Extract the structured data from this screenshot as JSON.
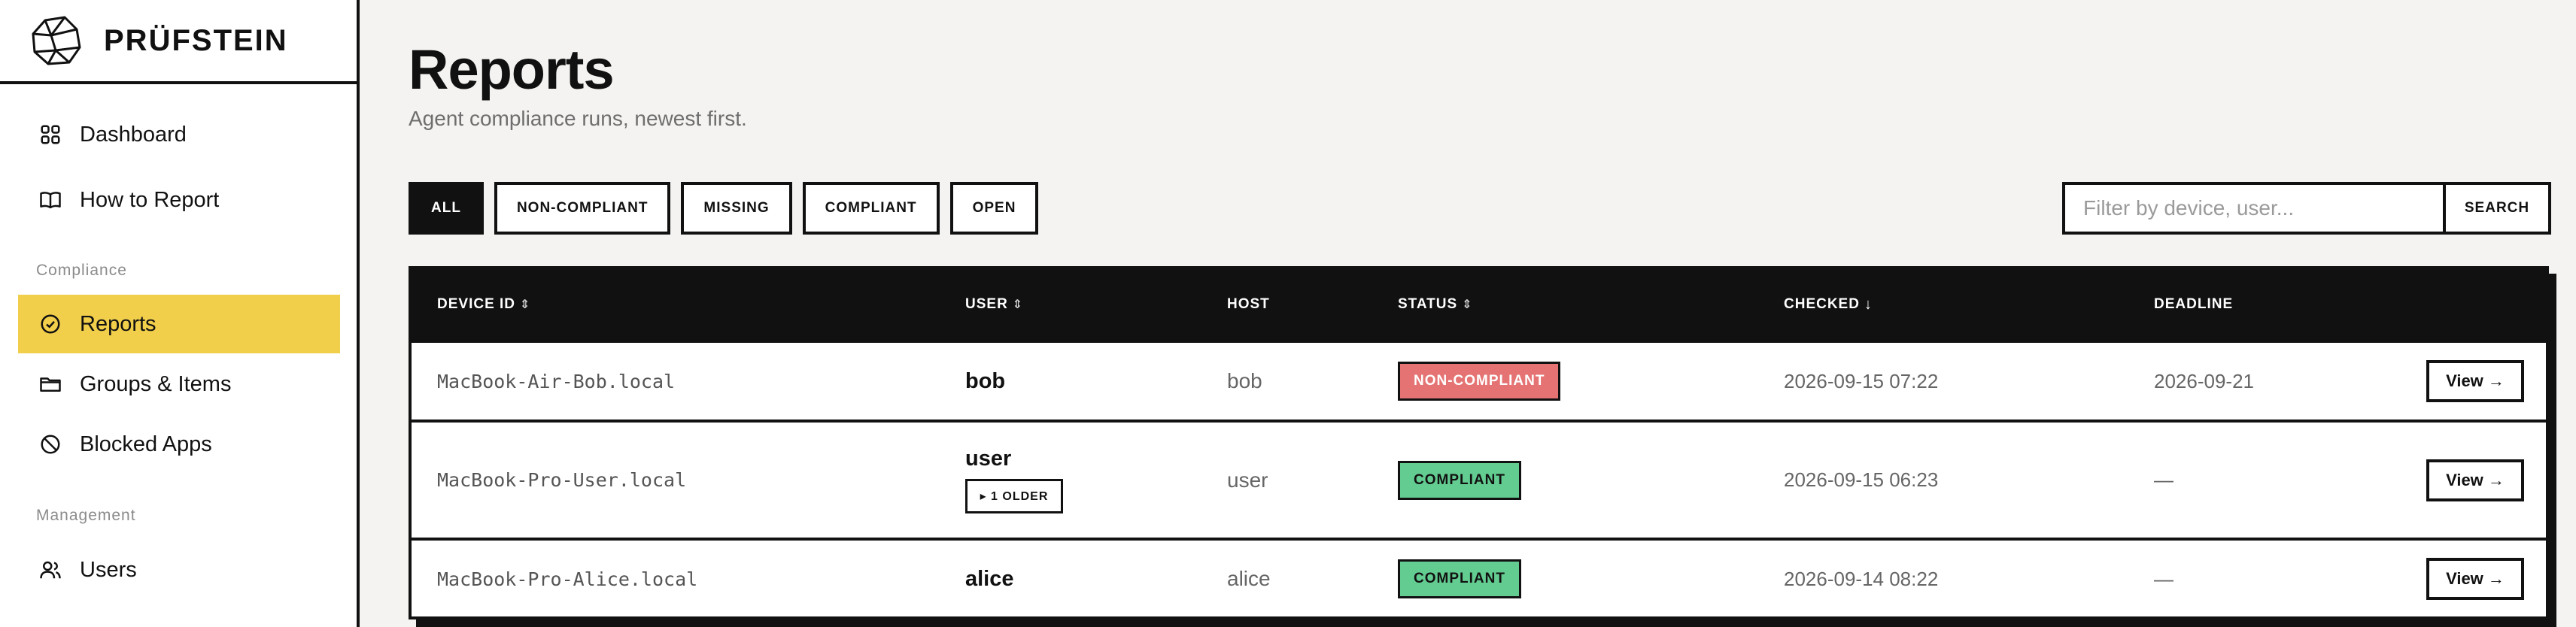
{
  "brand": {
    "name": "PRÜFSTEIN",
    "logo_icon": "stone-logo-icon"
  },
  "sidebar": {
    "items": [
      {
        "label": "Dashboard",
        "icon": "dashboard-grid-icon"
      },
      {
        "label": "How to Report",
        "icon": "book-icon"
      },
      {
        "label": "Reports",
        "icon": "check-circle-icon",
        "active": true
      },
      {
        "label": "Groups & Items",
        "icon": "folder-icon"
      },
      {
        "label": "Blocked Apps",
        "icon": "ban-icon"
      },
      {
        "label": "Users",
        "icon": "users-icon"
      }
    ],
    "sections": {
      "compliance": "Compliance",
      "management": "Management"
    }
  },
  "page": {
    "title": "Reports",
    "subtitle": "Agent compliance runs, newest first."
  },
  "filters": {
    "options": [
      "ALL",
      "NON-COMPLIANT",
      "MISSING",
      "COMPLIANT",
      "OPEN"
    ],
    "selected": "ALL"
  },
  "search": {
    "placeholder": "Filter by device, user...",
    "value": "",
    "button_label": "SEARCH"
  },
  "table": {
    "columns": {
      "device_id": "DEVICE ID",
      "user": "USER",
      "host": "HOST",
      "status": "STATUS",
      "checked": "CHECKED",
      "deadline": "DEADLINE"
    },
    "sort_indicators": {
      "neutral": "⇕",
      "descending": "↓"
    },
    "rows": [
      {
        "device_id": "MacBook-Air-Bob.local",
        "user": "bob",
        "older": "",
        "host": "bob",
        "status": "NON-COMPLIANT",
        "checked": "2026-09-15 07:22",
        "deadline": "2026-09-21",
        "action": "View →"
      },
      {
        "device_id": "MacBook-Pro-User.local",
        "user": "user",
        "older": "▸ 1 OLDER",
        "host": "user",
        "status": "COMPLIANT",
        "checked": "2026-09-15 06:23",
        "deadline": "—",
        "action": "View →"
      },
      {
        "device_id": "MacBook-Pro-Alice.local",
        "user": "alice",
        "older": "",
        "host": "alice",
        "status": "COMPLIANT",
        "checked": "2026-09-14 08:22",
        "deadline": "—",
        "action": "View →"
      }
    ]
  },
  "colors": {
    "accent": "#f2cf4b",
    "noncompliant": "#e57373",
    "compliant": "#63cc91",
    "ink": "#111111",
    "background": "#f4f3f1"
  }
}
